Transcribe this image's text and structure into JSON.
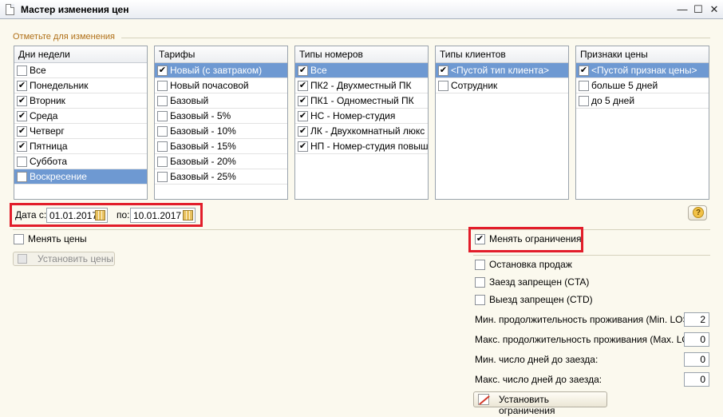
{
  "window": {
    "title": "Мастер изменения цен",
    "buttons": [
      "—",
      "☐",
      "✕"
    ]
  },
  "section_title": "Отметьте для изменения",
  "lists": [
    {
      "header": "Дни недели",
      "rows": [
        {
          "label": "Все",
          "checked": false
        },
        {
          "label": "Понедельник",
          "checked": true
        },
        {
          "label": "Вторник",
          "checked": true
        },
        {
          "label": "Среда",
          "checked": true
        },
        {
          "label": "Четверг",
          "checked": true
        },
        {
          "label": "Пятница",
          "checked": true
        },
        {
          "label": "Суббота",
          "checked": false
        },
        {
          "label": "Воскресение",
          "checked": false,
          "selected": true
        }
      ]
    },
    {
      "header": "Тарифы",
      "rows": [
        {
          "label": "Новый (с завтраком)",
          "checked": true,
          "selected": true
        },
        {
          "label": "Новый почасовой",
          "checked": false
        },
        {
          "label": "Базовый",
          "checked": false
        },
        {
          "label": "Базовый - 5%",
          "checked": false
        },
        {
          "label": "Базовый - 10%",
          "checked": false
        },
        {
          "label": "Базовый - 15%",
          "checked": false
        },
        {
          "label": "Базовый - 20%",
          "checked": false
        },
        {
          "label": "Базовый - 25%",
          "checked": false
        }
      ]
    },
    {
      "header": "Типы номеров",
      "rows": [
        {
          "label": "Все",
          "checked": true,
          "selected": true
        },
        {
          "label": "ПК2 - Двухместный ПК",
          "checked": true
        },
        {
          "label": "ПК1 - Одноместный ПК",
          "checked": true
        },
        {
          "label": "НС - Номер-студия",
          "checked": true
        },
        {
          "label": "ЛК - Двухкомнатный люкс",
          "checked": true
        },
        {
          "label": "НП - Номер-студия повыш...",
          "checked": true
        }
      ]
    },
    {
      "header": "Типы клиентов",
      "rows": [
        {
          "label": "<Пустой тип клиента>",
          "checked": true,
          "selected": true
        },
        {
          "label": "Сотрудник",
          "checked": false
        }
      ]
    },
    {
      "header": "Признаки цены",
      "rows": [
        {
          "label": "<Пустой признак цены>",
          "checked": true,
          "selected": true
        },
        {
          "label": "больше 5 дней",
          "checked": false
        },
        {
          "label": "до 5 дней",
          "checked": false
        }
      ]
    }
  ],
  "dates": {
    "from_label": "Дата с:",
    "from_value": "01.01.2017",
    "to_label": "по:",
    "to_value": "10.01.2017"
  },
  "help_icon": "question-mark-icon",
  "prices": {
    "change_label": "Менять цены",
    "change_checked": false,
    "set_button": "Установить цены"
  },
  "restrictions": {
    "change_label": "Менять ограничения",
    "change_checked": true,
    "checkboxes": [
      {
        "label": "Остановка продаж",
        "checked": false
      },
      {
        "label": "Заезд запрещен (CTA)",
        "checked": false
      },
      {
        "label": "Выезд запрещен (CTD)",
        "checked": false
      }
    ],
    "fields": [
      {
        "label": "Мин. продолжительность проживания (Min. LOS):",
        "value": "2"
      },
      {
        "label": "Макс. продолжительность проживания (Max. LOS):",
        "value": "0"
      },
      {
        "label": "Мин. число дней до заезда:",
        "value": "0"
      },
      {
        "label": "Макс. число дней до заезда:",
        "value": "0"
      }
    ],
    "set_button": "Установить ограничения"
  },
  "colors": {
    "highlight_border": "#e21d2a",
    "selection": "#6e99d2",
    "background": "#fbf9ee"
  }
}
